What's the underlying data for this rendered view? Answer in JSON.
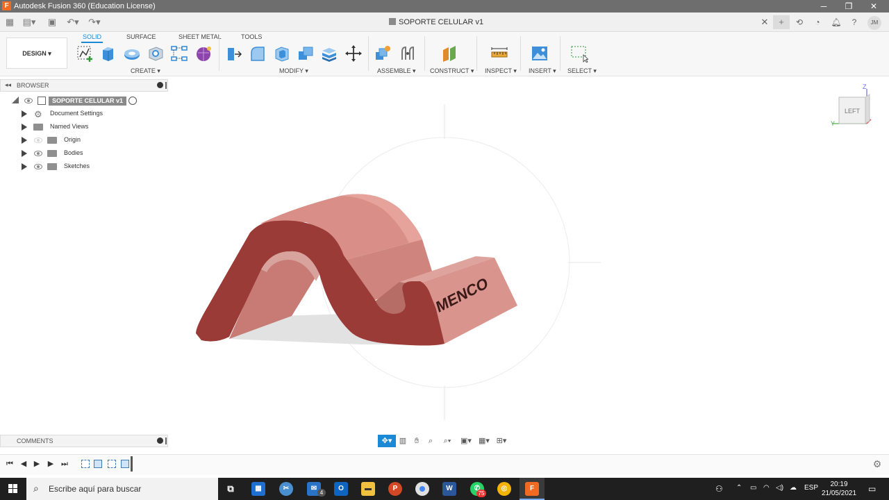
{
  "window": {
    "title": "Autodesk Fusion 360 (Education License)",
    "app_icon": "F",
    "controls": {
      "minimize": "─",
      "maximize": "❐",
      "close": "✕"
    }
  },
  "tabbar": {
    "document_title": "SOPORTE CELULAR v1",
    "close_glyph": "✕",
    "user_initials": "JM"
  },
  "toolbar": {
    "workspace_tabs": [
      "SOLID",
      "SURFACE",
      "SHEET METAL",
      "TOOLS"
    ],
    "design_label": "DESIGN ▾",
    "groups": [
      "CREATE ▾",
      "MODIFY ▾",
      "ASSEMBLE ▾",
      "CONSTRUCT ▾",
      "INSPECT ▾",
      "INSERT ▾",
      "SELECT ▾"
    ]
  },
  "browser": {
    "header": "BROWSER",
    "root": "SOPORTE CELULAR v1",
    "items": [
      "Document Settings",
      "Named Views",
      "Origin",
      "Bodies",
      "Sketches"
    ]
  },
  "comments": {
    "header": "COMMENTS"
  },
  "viewcube": {
    "face": "LEFT",
    "axis_z": "Z",
    "axis_y": "Y"
  },
  "model": {
    "engraved_text": "JORGE MENCO"
  },
  "taskbar": {
    "search_placeholder": "Escribe aquí para buscar",
    "mail_badge": "4",
    "whatsapp_badge": "75",
    "language": "ESP",
    "time": "20:19",
    "date": "21/05/2021"
  },
  "colors": {
    "accent": "#1a8ad6",
    "body_light": "#d98880",
    "body_dark": "#9a3b37"
  }
}
